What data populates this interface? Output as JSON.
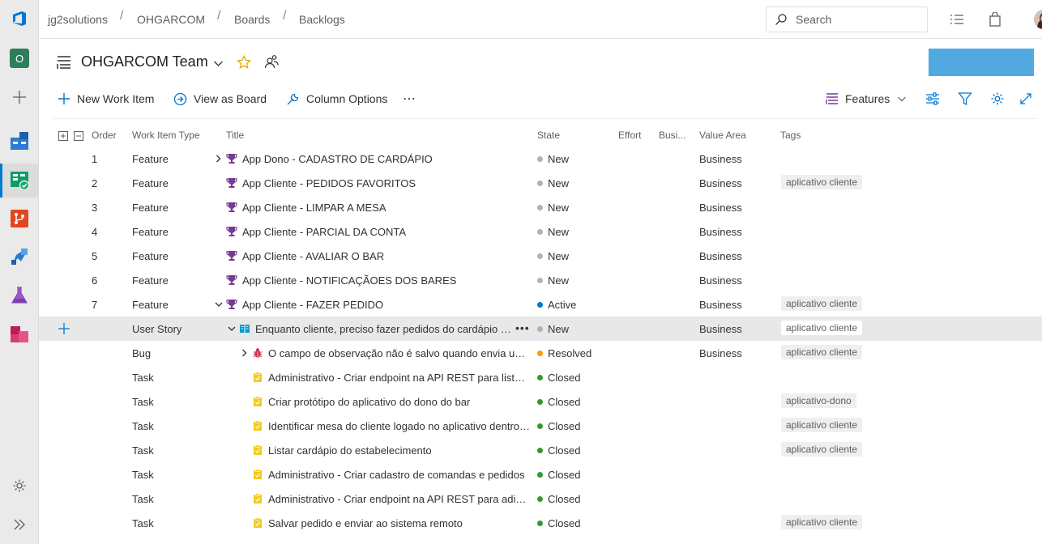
{
  "breadcrumb": [
    "jg2solutions",
    "OHGARCOM",
    "Boards",
    "Backlogs"
  ],
  "search": {
    "placeholder": "Search"
  },
  "rail": {
    "project_initial": "O"
  },
  "team": {
    "name": "OHGARCOM Team"
  },
  "toolbar": {
    "new_work_item": "New Work Item",
    "view_as_board": "View as Board",
    "column_options": "Column Options",
    "more": "⋯",
    "level": "Features"
  },
  "columns": [
    "Order",
    "Work Item Type",
    "Title",
    "State",
    "Effort",
    "Busi...",
    "Value Area",
    "Tags"
  ],
  "state_colors": {
    "New": "#b2b2b2",
    "Active": "#007acc",
    "Resolved": "#ff9d00",
    "Closed": "#339933"
  },
  "rows": [
    {
      "order": "1",
      "type": "Feature",
      "title": "App Dono - CADASTRO DE CARDÁPIO",
      "state": "New",
      "value_area": "Business",
      "tag": "",
      "icon": "trophy-icon",
      "expander": "collapsed"
    },
    {
      "order": "2",
      "type": "Feature",
      "title": "App Cliente - PEDIDOS FAVORITOS",
      "state": "New",
      "value_area": "Business",
      "tag": "aplicativo cliente",
      "icon": "trophy-icon",
      "expander": ""
    },
    {
      "order": "3",
      "type": "Feature",
      "title": "App Cliente - LIMPAR A MESA",
      "state": "New",
      "value_area": "Business",
      "tag": "",
      "icon": "trophy-icon",
      "expander": ""
    },
    {
      "order": "4",
      "type": "Feature",
      "title": "App Cliente - PARCIAL DA CONTA",
      "state": "New",
      "value_area": "Business",
      "tag": "",
      "icon": "trophy-icon",
      "expander": ""
    },
    {
      "order": "5",
      "type": "Feature",
      "title": "App Cliente - AVALIAR O BAR",
      "state": "New",
      "value_area": "Business",
      "tag": "",
      "icon": "trophy-icon",
      "expander": ""
    },
    {
      "order": "6",
      "type": "Feature",
      "title": "App Cliente - NOTIFICAÇÃOES DOS BARES",
      "state": "New",
      "value_area": "Business",
      "tag": "",
      "icon": "trophy-icon",
      "expander": ""
    },
    {
      "order": "7",
      "type": "Feature",
      "title": "App Cliente - FAZER PEDIDO",
      "state": "Active",
      "value_area": "Business",
      "tag": "aplicativo cliente",
      "icon": "trophy-icon",
      "expander": "expanded"
    },
    {
      "order": "",
      "type": "User Story",
      "title": "Enquanto cliente, preciso fazer pedidos do cardápio do bar",
      "state": "New",
      "value_area": "Business",
      "tag": "aplicativo cliente",
      "icon": "book-icon",
      "expander": "expanded"
    },
    {
      "order": "",
      "type": "Bug",
      "title": "O campo de observação não é salvo quando envia um pedido",
      "state": "Resolved",
      "value_area": "Business",
      "tag": "aplicativo cliente",
      "icon": "bug-icon",
      "expander": "collapsed"
    },
    {
      "order": "",
      "type": "Task",
      "title": "Administrativo - Criar endpoint na API REST para listar pedidos",
      "state": "Closed",
      "value_area": "",
      "tag": "",
      "icon": "clipboard-icon",
      "expander": ""
    },
    {
      "order": "",
      "type": "Task",
      "title": "Criar protótipo do aplicativo do dono do bar",
      "state": "Closed",
      "value_area": "",
      "tag": "aplicativo-dono",
      "icon": "clipboard-icon",
      "expander": ""
    },
    {
      "order": "",
      "type": "Task",
      "title": "Identificar mesa do cliente logado no aplicativo dentro do bar",
      "state": "Closed",
      "value_area": "",
      "tag": "aplicativo cliente",
      "icon": "clipboard-icon",
      "expander": ""
    },
    {
      "order": "",
      "type": "Task",
      "title": "Listar cardápio do estabelecimento",
      "state": "Closed",
      "value_area": "",
      "tag": "aplicativo cliente",
      "icon": "clipboard-icon",
      "expander": ""
    },
    {
      "order": "",
      "type": "Task",
      "title": "Administrativo - Criar cadastro de comandas e pedidos",
      "state": "Closed",
      "value_area": "",
      "tag": "",
      "icon": "clipboard-icon",
      "expander": ""
    },
    {
      "order": "",
      "type": "Task",
      "title": "Administrativo - Criar endpoint na API REST para adicionar pedidos",
      "state": "Closed",
      "value_area": "",
      "tag": "",
      "icon": "clipboard-icon",
      "expander": ""
    },
    {
      "order": "",
      "type": "Task",
      "title": "Salvar pedido e enviar ao sistema remoto",
      "state": "Closed",
      "value_area": "",
      "tag": "aplicativo cliente",
      "icon": "clipboard-icon",
      "expander": ""
    }
  ]
}
